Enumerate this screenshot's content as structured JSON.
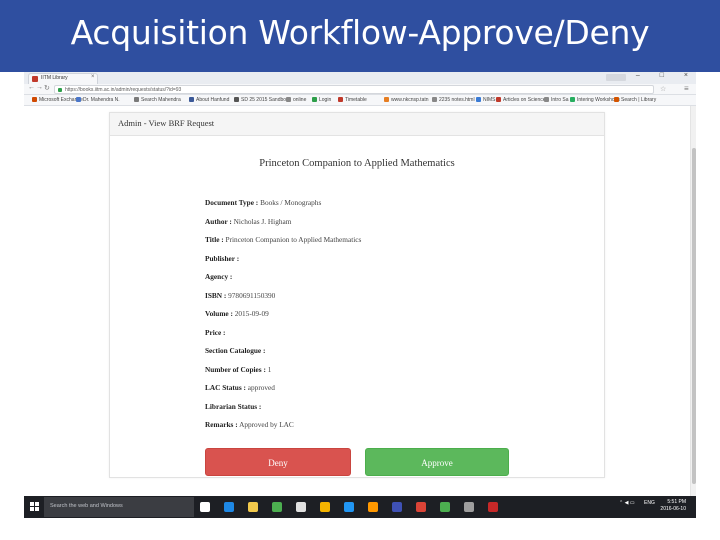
{
  "slide": {
    "title": "Acquisition Workflow-Approve/Deny"
  },
  "browser": {
    "tab_title": "IITM Library",
    "tab_close": "×",
    "window_controls": [
      "–",
      "□",
      "×"
    ],
    "url": "https://books.iitm.ac.in/admin/requests/status/?id=93",
    "bookmarks": [
      {
        "label": "Microsoft Exchange",
        "color": "#d04a02"
      },
      {
        "label": "Dr. Mahendra N.",
        "color": "#4a76c9"
      },
      {
        "label": "Search Mahendra",
        "color": "#7a7a7a"
      },
      {
        "label": "About Hanfund",
        "color": "#3b5998"
      },
      {
        "label": "SD 25 2015 Sandbox",
        "color": "#555555"
      },
      {
        "label": "online",
        "color": "#888888"
      },
      {
        "label": "Login",
        "color": "#2e9f4a"
      },
      {
        "label": "Timetable",
        "color": "#c0392b"
      },
      {
        "label": "www.nkcnsp.tatn",
        "color": "#e67e22"
      },
      {
        "label": "2235 notes.html",
        "color": "#888888"
      },
      {
        "label": "NIMS",
        "color": "#3a7bd5"
      },
      {
        "label": "Articles on Science",
        "color": "#c0392b"
      },
      {
        "label": "Intro Sa",
        "color": "#888888"
      },
      {
        "label": "Intering Workshops",
        "color": "#27ae60"
      },
      {
        "label": "Search | Library",
        "color": "#d35400"
      }
    ]
  },
  "page": {
    "panel_heading": "Admin - View BRF Request",
    "book_title": "Princeton Companion to Applied Mathematics",
    "fields": [
      {
        "label": "Document Type :",
        "value": "Books / Monographs"
      },
      {
        "label": "Author :",
        "value": "Nicholas J. Higham"
      },
      {
        "label": "Title :",
        "value": "Princeton Companion to Applied Mathematics"
      },
      {
        "label": "Publisher :",
        "value": ""
      },
      {
        "label": "Agency :",
        "value": ""
      },
      {
        "label": "ISBN :",
        "value": "9780691150390"
      },
      {
        "label": "Volume :",
        "value": "2015-09-09"
      },
      {
        "label": "Price :",
        "value": ""
      },
      {
        "label": "Section Catalogue :",
        "value": ""
      },
      {
        "label": "Number of Copies :",
        "value": "1"
      },
      {
        "label": "LAC Status :",
        "value": "approved"
      },
      {
        "label": "Librarian Status :",
        "value": ""
      },
      {
        "label": "Remarks :",
        "value": "Approved by LAC"
      }
    ],
    "deny_label": "Deny",
    "approve_label": "Approve"
  },
  "taskbar": {
    "search_placeholder": "Search the web and Windows",
    "language": "ENG",
    "time": "5:51 PM",
    "date": "2016-06-10",
    "app_icon_colors": [
      "#ffffff",
      "#1e88e5",
      "#f2c94c",
      "#4caf50",
      "#e0e0e0",
      "#f4b400",
      "#2196f3",
      "#ff9800",
      "#3f51b5",
      "#db4437",
      "#4caf50",
      "#9e9e9e",
      "#c62828"
    ]
  }
}
